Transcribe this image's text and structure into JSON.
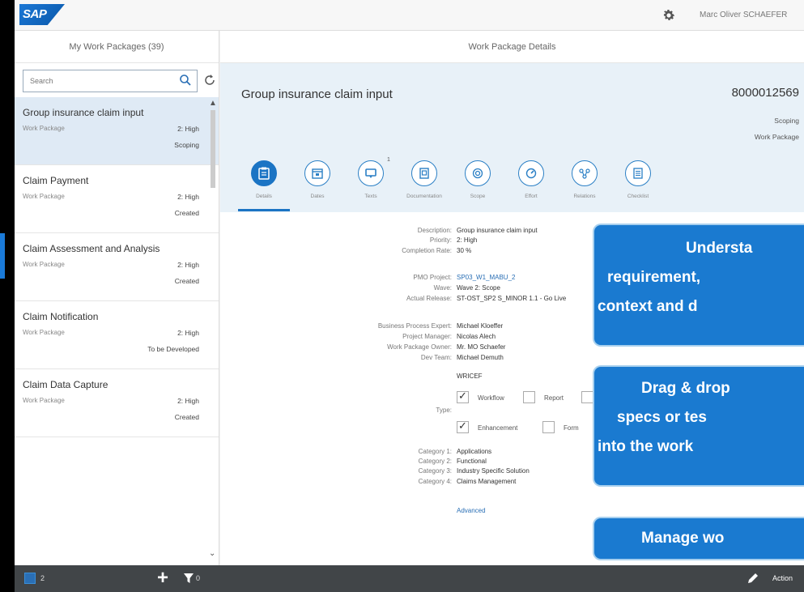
{
  "shell": {
    "logo_text": "SAP",
    "user_name": "Marc Oliver SCHAEFER",
    "gear_icon": "gear-icon"
  },
  "master": {
    "title": "My Work Packages (39)",
    "search_placeholder": "Search",
    "items": [
      {
        "title": "Group insurance claim input",
        "type": "Work Package",
        "priority": "2: High",
        "status": "Scoping",
        "selected": true
      },
      {
        "title": "Claim Payment",
        "type": "Work Package",
        "priority": "2: High",
        "status": "Created"
      },
      {
        "title": "Claim Assessment and Analysis",
        "type": "Work Package",
        "priority": "2: High",
        "status": "Created"
      },
      {
        "title": "Claim Notification",
        "type": "Work Package",
        "priority": "2: High",
        "status": "To be Developed"
      },
      {
        "title": "Claim Data Capture",
        "type": "Work Package",
        "priority": "2: High",
        "status": "Created"
      }
    ]
  },
  "detail": {
    "title": "Work Package Details",
    "object": {
      "title": "Group insurance claim input",
      "number": "8000012569",
      "status": "Scoping",
      "type": "Work Package"
    },
    "tabs": [
      {
        "label": "Details",
        "icon": "clipboard-icon",
        "active": true
      },
      {
        "label": "Dates",
        "icon": "calendar-icon"
      },
      {
        "label": "Texts",
        "icon": "speech-bubble-icon",
        "badge": "1"
      },
      {
        "label": "Documentation",
        "icon": "document-icon"
      },
      {
        "label": "Scope",
        "icon": "scope-icon"
      },
      {
        "label": "Effort",
        "icon": "gauge-icon"
      },
      {
        "label": "Relations",
        "icon": "network-icon"
      },
      {
        "label": "Checklist",
        "icon": "checklist-icon"
      }
    ],
    "fields": {
      "description": {
        "label": "Description:",
        "value": "Group insurance claim input"
      },
      "priority": {
        "label": "Priority:",
        "value": "2: High"
      },
      "completion": {
        "label": "Completion Rate:",
        "value": "30 %"
      },
      "pmo": {
        "label": "PMO Project:",
        "value": "SP03_W1_MABU_2"
      },
      "wave": {
        "label": "Wave:",
        "value": "Wave 2: Scope"
      },
      "release": {
        "label": "Actual Release:",
        "value": "ST-OST_SP2 S_MINOR 1.1 - Go Live"
      },
      "bpe": {
        "label": "Business Process Expert:",
        "value": "Michael Kloeffer"
      },
      "pm": {
        "label": "Project Manager:",
        "value": "Nicolas Alech"
      },
      "wpo": {
        "label": "Work Package Owner:",
        "value": "Mr. MO Schaefer"
      },
      "devteam": {
        "label": "Dev Team:",
        "value": "Michael Demuth"
      },
      "wricef": "WRICEF",
      "type_label": "Type:",
      "type_options": [
        {
          "label": "Workflow",
          "checked": true
        },
        {
          "label": "Report",
          "checked": false
        },
        {
          "label": "Enhancement",
          "checked": true
        },
        {
          "label": "Form",
          "checked": false
        }
      ],
      "cat1": {
        "label": "Category 1:",
        "value": "Applications"
      },
      "cat2": {
        "label": "Category 2:",
        "value": "Functional"
      },
      "cat3": {
        "label": "Category 3:",
        "value": "Industry Specific Solution"
      },
      "cat4": {
        "label": "Category 4:",
        "value": "Claims Management"
      },
      "advanced": "Advanced"
    }
  },
  "callouts": [
    {
      "lines": [
        "Understa",
        "requirement,",
        "context and d"
      ]
    },
    {
      "lines": [
        "Drag & drop",
        "specs or tes",
        "into the work"
      ]
    },
    {
      "lines": [
        "Manage wo"
      ]
    }
  ],
  "footer": {
    "count_left": "2",
    "count_filter": "0",
    "action_label": "Action"
  },
  "colors": {
    "accent": "#1b74c4",
    "selected_row": "#dfeaf5",
    "header_bg": "#e8f1f8",
    "callout": "#1a7ad0",
    "footer": "#414548"
  }
}
